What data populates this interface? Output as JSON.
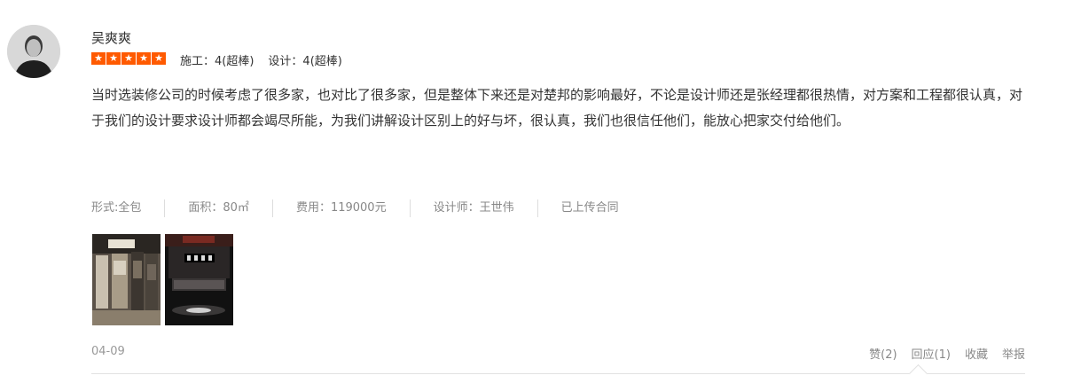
{
  "review": {
    "username": "吴爽爽",
    "rating_stars": 5,
    "scores": {
      "construction": "施工：4(超棒)",
      "design": "设计：4(超棒)"
    },
    "comment": "当时选装修公司的时候考虑了很多家，也对比了很多家，但是整体下来还是对楚邦的影响最好，不论是设计师还是张经理都很热情，对方案和工程都很认真，对于我们的设计要求设计师都会竭尽所能，为我们讲解设计区别上的好与坏，很认真，我们也很信任他们，能放心把家交付给他们。",
    "meta": {
      "form": "形式:全包",
      "area": "面积：80㎡",
      "cost": "费用：119000元",
      "designer": "设计师：王世伟",
      "contract": "已上传合同"
    },
    "date": "04-09",
    "actions": {
      "like": "赞(2)",
      "reply": "回应(1)",
      "favorite": "收藏",
      "report": "举报"
    },
    "star_color": "#ff5a00"
  }
}
